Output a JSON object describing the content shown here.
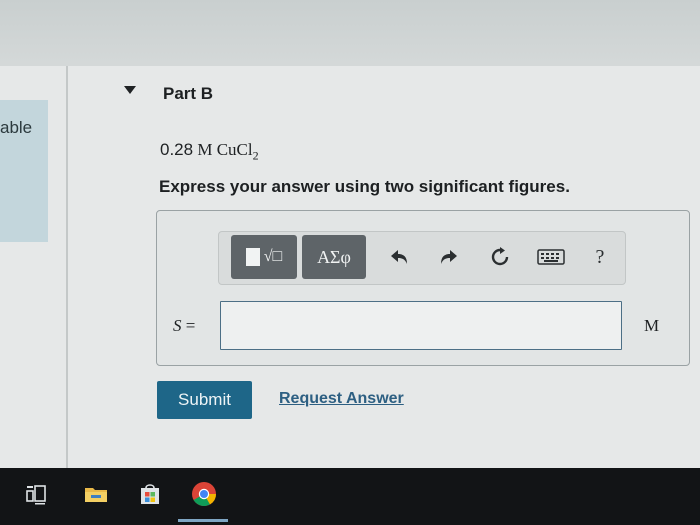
{
  "sidebar": {
    "label": "able"
  },
  "part": {
    "title": "Part B"
  },
  "question": {
    "concentration": "0.28",
    "unit_prefix": "M",
    "formula": "CuCl",
    "subscript": "2",
    "instruction": "Express your answer using two significant figures."
  },
  "toolbar": {
    "templates_label": "√□",
    "symbols_label": "ΑΣφ",
    "undo_icon": "undo-icon",
    "redo_icon": "redo-icon",
    "reset_icon": "reset-icon",
    "keyboard_icon": "keyboard-icon",
    "help_label": "?"
  },
  "answer": {
    "variable": "S",
    "equals": "=",
    "value": "",
    "unit": "M"
  },
  "actions": {
    "submit_label": "Submit",
    "request_label": "Request Answer"
  },
  "taskbar": {
    "items": [
      "task-view-icon",
      "file-explorer-icon",
      "store-icon",
      "chrome-icon"
    ]
  },
  "colors": {
    "submit_bg": "#1e6688",
    "link": "#2d5f82",
    "toolbar_btn": "#5e6468",
    "input_border": "#4c6f86"
  }
}
